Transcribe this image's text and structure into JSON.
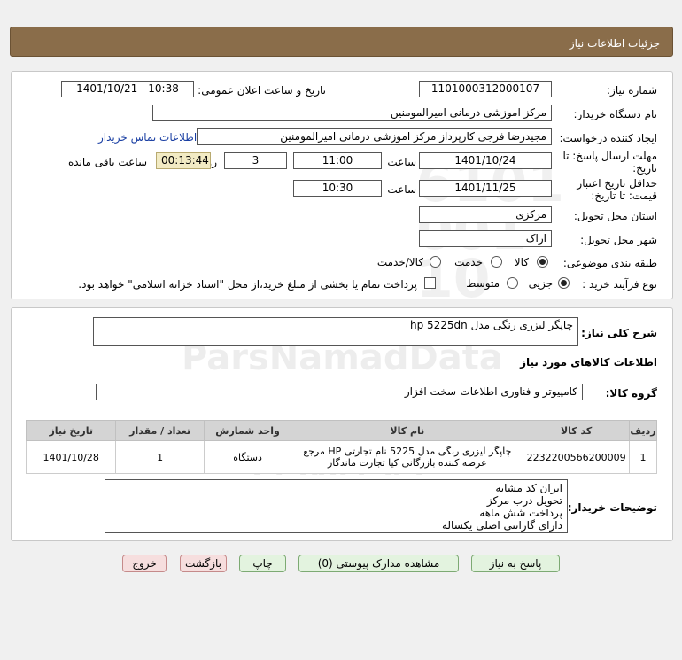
{
  "header": {
    "title": "جزئیات اطلاعات نیاز"
  },
  "form": {
    "need_number_label": "شماره نیاز:",
    "need_number": "1101000312000107",
    "announce_label": "تاریخ و ساعت اعلان عمومی:",
    "announce_value": "1401/10/21 - 10:38",
    "buyer_org_label": "نام دستگاه خریدار:",
    "buyer_org": "مرکز اموزشی درمانی امیرالمومنین",
    "requester_label": "ایجاد کننده درخواست:",
    "requester": "مجیدرضا فرجی کارپرداز مرکز اموزشی درمانی امیرالمومنین",
    "contact_link": "اطلاعات تماس خریدار",
    "deadline_label_1": "مهلت ارسال پاسخ: تا",
    "deadline_label_2": "تاریخ:",
    "deadline_date": "1401/10/24",
    "time_label": "ساعت",
    "deadline_time": "11:00",
    "days_value": "3",
    "days_label": "روز و",
    "remaining_time": "00:13:44",
    "remaining_label": "ساعت باقی مانده",
    "validity_label_1": "حداقل تاریخ اعتبار",
    "validity_label_2": "قیمت: تا تاریخ:",
    "validity_date": "1401/11/25",
    "validity_time": "10:30",
    "province_label": "استان محل تحویل:",
    "province": "مرکزی",
    "city_label": "شهر محل تحویل:",
    "city": "اراک",
    "category_label": "طبقه بندی موضوعی:",
    "category_options": [
      "کالا",
      "خدمت",
      "کالا/خدمت"
    ],
    "purchase_type_label": "نوع فرآیند خرید :",
    "purchase_options": [
      "جزیی",
      "متوسط"
    ],
    "payment_note": "پرداخت تمام یا بخشی از مبلغ خرید،از محل \"اسناد خزانه اسلامی\" خواهد بود."
  },
  "summary": {
    "general_desc_label": "شرح کلی نیاز:",
    "general_desc": "چاپگر لیزری رنگی مدل hp 5225dn",
    "goods_info_title": "اطلاعات کالاهای مورد نیاز",
    "goods_group_label": "گروه کالا:",
    "goods_group": "کامپیوتر و فناوری اطلاعات-سخت افزار"
  },
  "table": {
    "headers": [
      "ردیف",
      "کد کالا",
      "نام کالا",
      "واحد شمارش",
      "تعداد / مقدار",
      "تاریخ نیاز"
    ],
    "rows": [
      [
        "1",
        "2232200566200009",
        "چاپگر لیزری رنگی مدل 5225 نام تجارتی HP مرجع عرضه کننده بازرگانی کیا تجارت ماندگار",
        "دستگاه",
        "1",
        "1401/10/28"
      ]
    ]
  },
  "buyer_notes": {
    "label": "توضیحات خریدار:",
    "lines": [
      "ایران کد مشابه",
      "تحویل درب مرکز",
      "پرداخت شش ماهه",
      "دارای گارانتی اصلی یکساله"
    ]
  },
  "buttons": {
    "reply": "پاسخ به نیاز",
    "view_docs": "مشاهده مدارک پیوستی (0)",
    "print": "چاپ",
    "back": "بازگشت",
    "exit": "خروج"
  }
}
